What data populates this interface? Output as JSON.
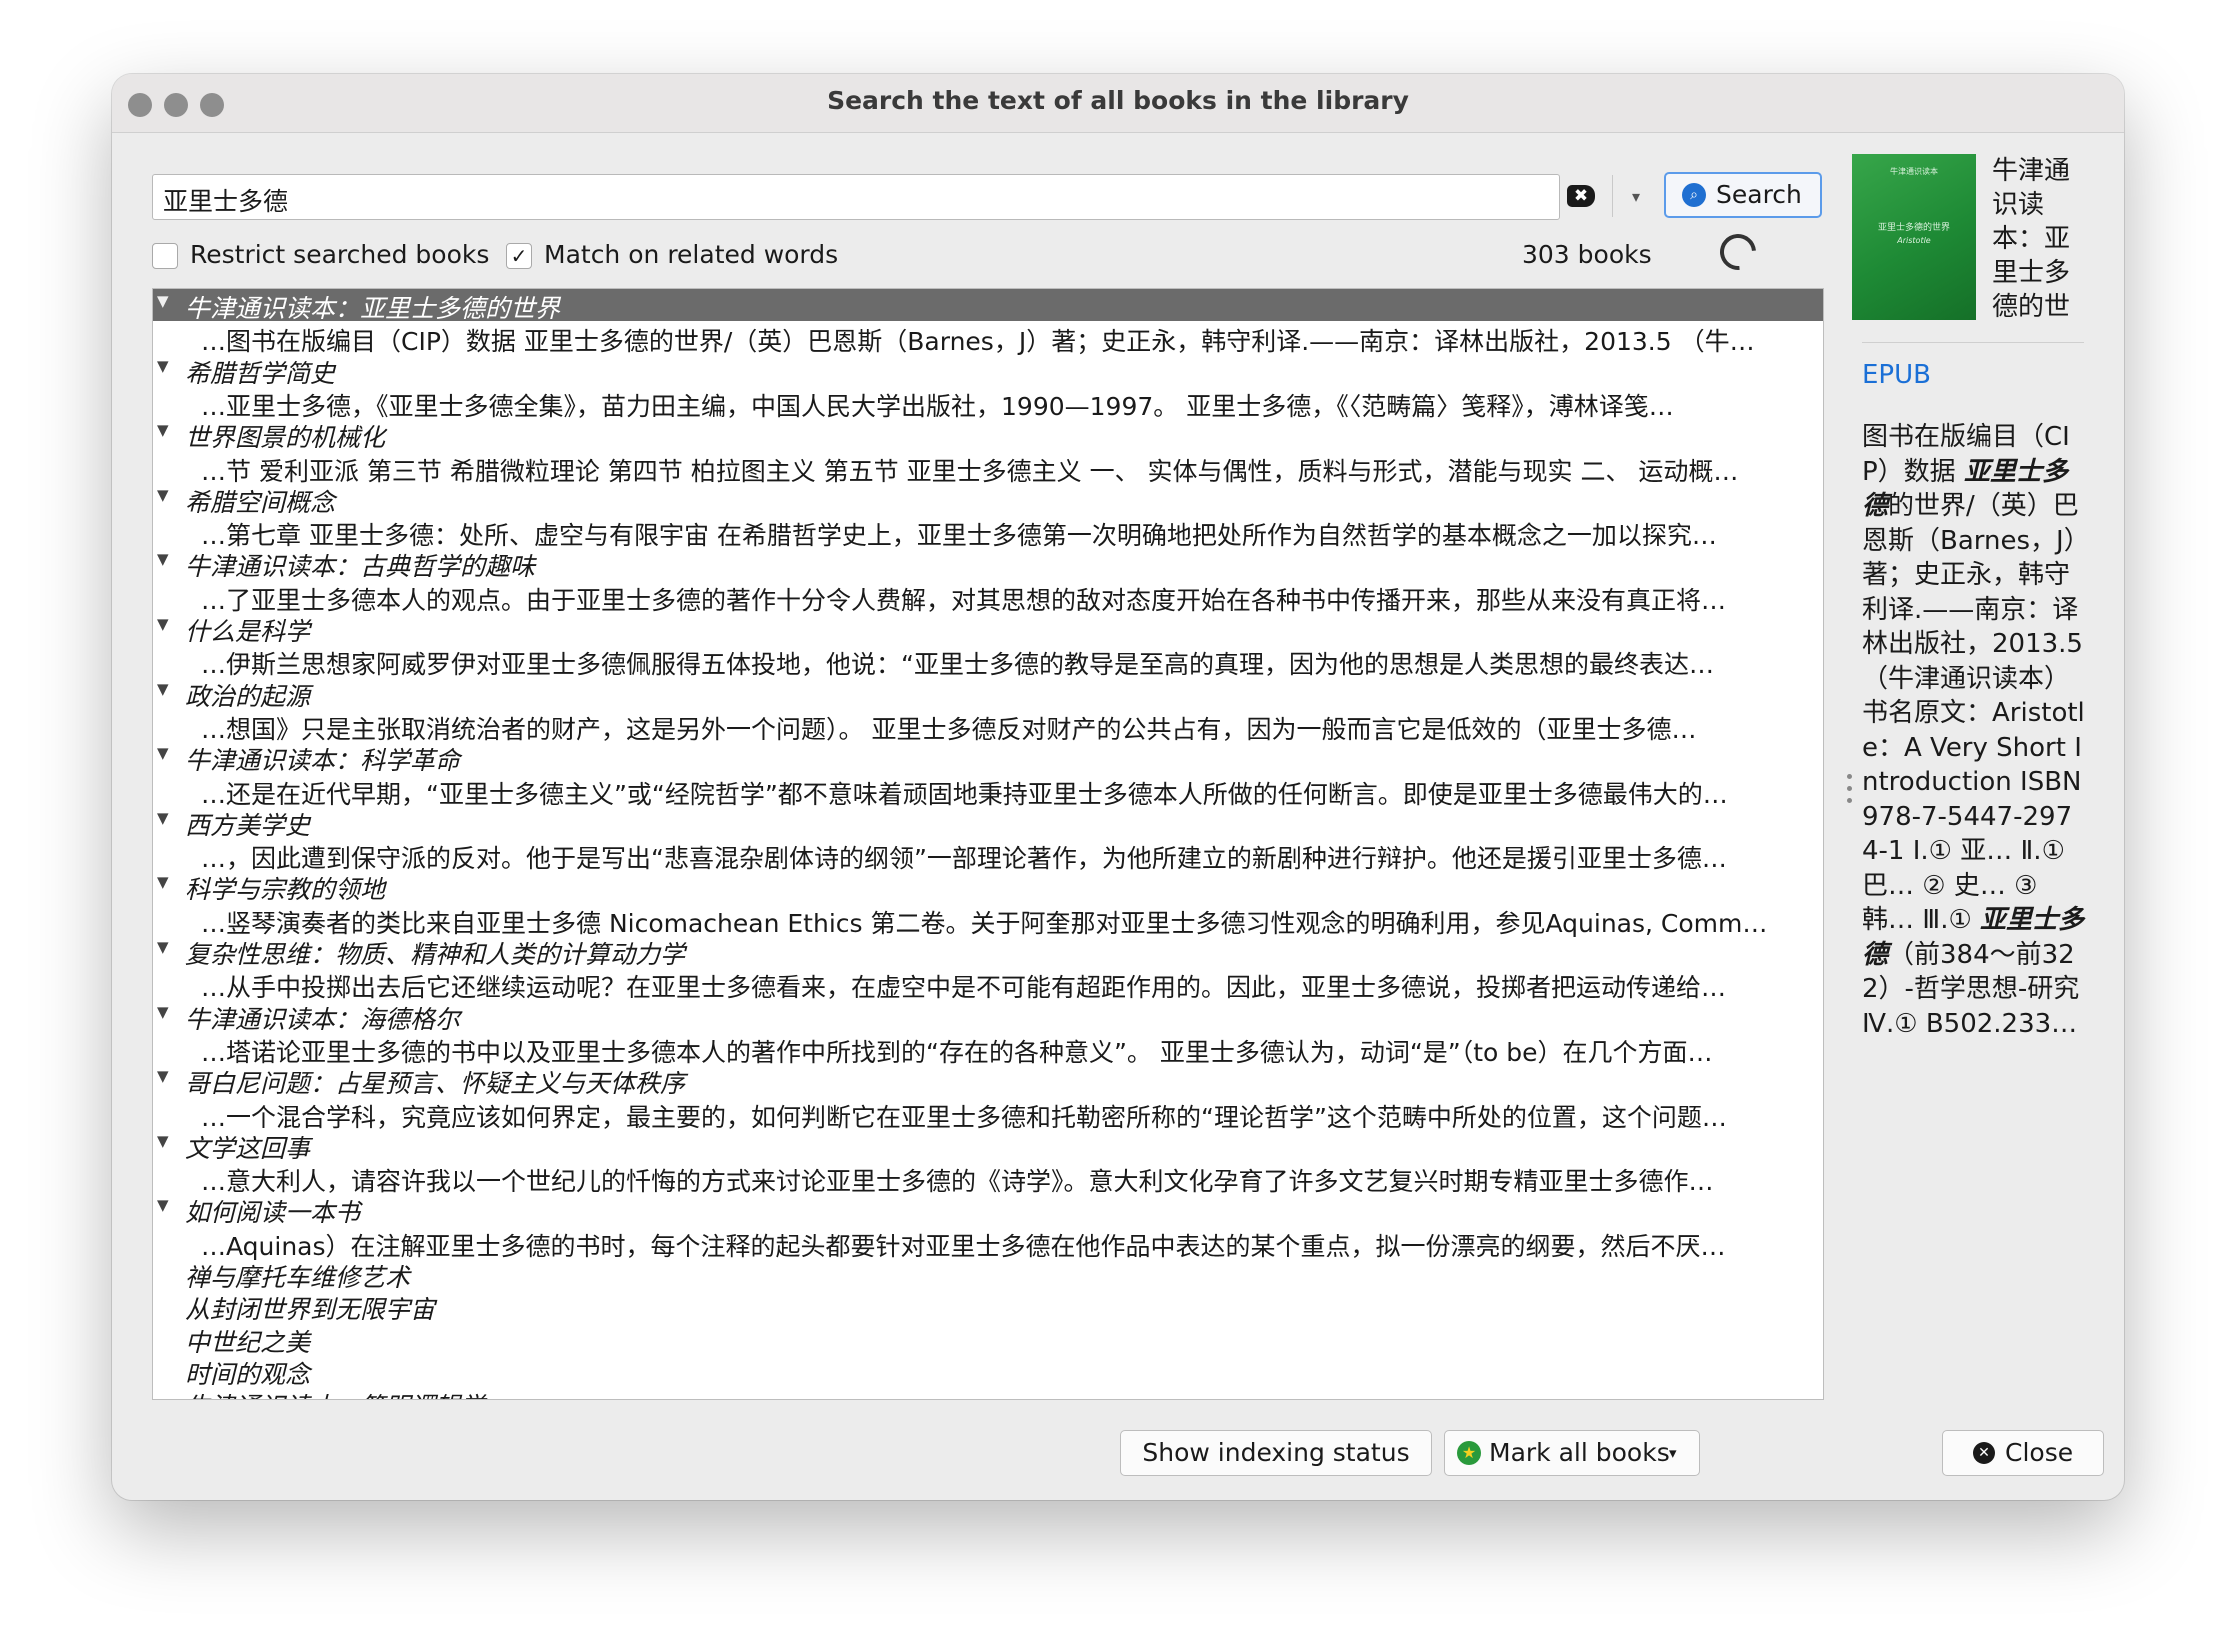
{
  "window": {
    "title": "Search the text of all books in the library"
  },
  "search": {
    "query": "亚里士多德",
    "clear_icon": "✖",
    "dropdown_icon": "▾",
    "button_label": "Search",
    "button_icon": "⌕"
  },
  "options": {
    "restrict_label": "Restrict searched books",
    "restrict_checked": false,
    "related_label": "Match on related words",
    "related_checked": true,
    "related_check_glyph": "✓",
    "books_count": "303 books"
  },
  "results": [
    {
      "book": "牛津通识读本：亚里士多德的世界",
      "snippet": "…图书在版编目（CIP）数据 亚里士多德的世界/（英）巴恩斯（Barnes，J）著；史正永，韩守利译.——南京：译林出版社，2013.5 （牛…"
    },
    {
      "book": "希腊哲学简史",
      "snippet": "…亚里士多德，《亚里士多德全集》，苗力田主编，中国人民大学出版社，1990—1997。 亚里士多德，《〈范畴篇〉笺释》，溥林译笺…"
    },
    {
      "book": "世界图景的机械化",
      "snippet": "…节 爱利亚派 第三节 希腊微粒理论 第四节 柏拉图主义 第五节 亚里士多德主义 一、 实体与偶性，质料与形式，潜能与现实 二、 运动概…"
    },
    {
      "book": "希腊空间概念",
      "snippet": "…第七章 亚里士多德：处所、虚空与有限宇宙 在希腊哲学史上，亚里士多德第一次明确地把处所作为自然哲学的基本概念之一加以探究…"
    },
    {
      "book": "牛津通识读本：古典哲学的趣味",
      "snippet": "…了亚里士多德本人的观点。由于亚里士多德的著作十分令人费解，对其思想的敌对态度开始在各种书中传播开来，那些从来没有真正将…"
    },
    {
      "book": "什么是科学",
      "snippet": "…伊斯兰思想家阿威罗伊对亚里士多德佩服得五体投地，他说：“亚里士多德的教导是至高的真理，因为他的思想是人类思想的最终表达…"
    },
    {
      "book": "政治的起源",
      "snippet": "…想国》只是主张取消统治者的财产，这是另外一个问题）。 亚里士多德反对财产的公共占有，因为一般而言它是低效的（亚里士多德…"
    },
    {
      "book": "牛津通识读本：科学革命",
      "snippet": "…还是在近代早期，“亚里士多德主义”或“经院哲学”都不意味着顽固地秉持亚里士多德本人所做的任何断言。即使是亚里士多德最伟大的…"
    },
    {
      "book": "西方美学史",
      "snippet": "…，因此遭到保守派的反对。他于是写出“悲喜混杂剧体诗的纲领”一部理论著作，为他所建立的新剧种进行辩护。他还是援引亚里士多德…"
    },
    {
      "book": "科学与宗教的领地",
      "snippet": "…竖琴演奏者的类比来自亚里士多德 Nicomachean Ethics 第二卷。关于阿奎那对亚里士多德习性观念的明确利用，参见Aquinas, Comm…"
    },
    {
      "book": "复杂性思维：物质、精神和人类的计算动力学",
      "snippet": "…从手中投掷出去后它还继续运动呢？在亚里士多德看来，在虚空中是不可能有超距作用的。因此，亚里士多德说，投掷者把运动传递给…"
    },
    {
      "book": "牛津通识读本：海德格尔",
      "snippet": "…塔诺论亚里士多德的书中以及亚里士多德本人的著作中所找到的“存在的各种意义”。 亚里士多德认为，动词“是”（to be）在几个方面…"
    },
    {
      "book": "哥白尼问题：占星预言、怀疑主义与天体秩序",
      "snippet": "…一个混合学科，究竟应该如何界定，最主要的，如何判断它在亚里士多德和托勒密所称的“理论哲学”这个范畴中所处的位置，这个问题…"
    },
    {
      "book": "文学这回事",
      "snippet": "…意大利人，请容许我以一个世纪儿的忏悔的方式来讨论亚里士多德的《诗学》。意大利文化孕育了许多文艺复兴时期专精亚里士多德作…"
    },
    {
      "book": "如何阅读一本书",
      "snippet": "…Aquinas）在注解亚里士多德的书时，每个注释的起头都要针对亚里士多德在他作品中表达的某个重点，拟一份漂亮的纲要，然后不厌…"
    }
  ],
  "collapsed_books": [
    "禅与摩托车维修艺术",
    "从封闭世界到无限宇宙",
    "中世纪之美",
    "时间的观念",
    "牛津通识读本：简明逻辑学"
  ],
  "tree_expand_icon": "▼",
  "details": {
    "cover_caption_top": "牛津通识读本",
    "cover_caption_main": "亚里士多德的世界",
    "cover_caption_en": "Aristotle",
    "title": "牛津通识读本：亚里士多德的世",
    "format": "EPUB",
    "desc_1": "图书在版编目（CIP）数据 ",
    "desc_hl_1": "亚里士多德",
    "desc_2": "的世界/（英）巴恩斯（Barnes，J）著；史正永，韩守利译.——南京：译林出版社，2013.5 （牛津通识读本） 书名原文：Aristotle：A Very Short Introduction ISBN 978-7-5447-2974-1 Ⅰ.① 亚… Ⅱ.① 巴… ② 史… ③ 韩… Ⅲ.① ",
    "desc_hl_2": "亚里士多德",
    "desc_3": "（前384～前322）-哲学思想-研究 Ⅳ.① B502.233…"
  },
  "footer": {
    "indexing_label": "Show indexing status",
    "mark_label": "Mark all books",
    "mark_icon": "★",
    "mark_arrow": "▾",
    "close_label": "Close",
    "close_icon": "✕"
  }
}
